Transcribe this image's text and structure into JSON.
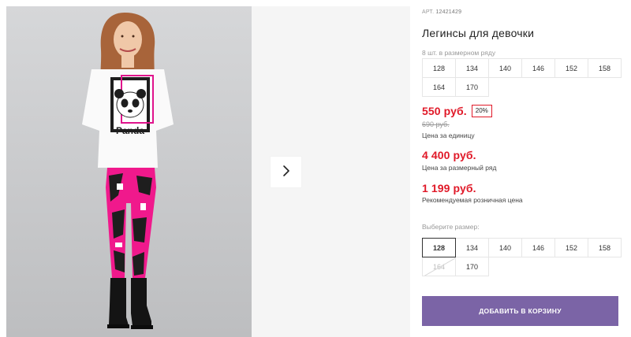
{
  "product": {
    "article_label": "АРТ.",
    "article_number": "12421429",
    "title": "Легинсы для девочки",
    "row_label": "8 шт. в размерном ряду",
    "row_sizes": [
      "128",
      "134",
      "140",
      "146",
      "152",
      "158",
      "164",
      "170"
    ]
  },
  "pricing": {
    "unit_price": "550 руб.",
    "discount_badge": "20%",
    "old_price": "690 руб.",
    "unit_label": "Цена за единицу",
    "row_price": "4 400 руб.",
    "row_label": "Цена за размерный ряд",
    "rrp_price": "1 199 руб.",
    "rrp_label": "Рекомендуемая розничная цена",
    "accent_color": "#e01928"
  },
  "size_select": {
    "label": "Выберите размер:",
    "selected": "128",
    "sizes": [
      {
        "value": "128",
        "state": "selected"
      },
      {
        "value": "134",
        "state": "available"
      },
      {
        "value": "140",
        "state": "available"
      },
      {
        "value": "146",
        "state": "available"
      },
      {
        "value": "152",
        "state": "available"
      },
      {
        "value": "158",
        "state": "available"
      },
      {
        "value": "164",
        "state": "unavailable"
      },
      {
        "value": "170",
        "state": "available"
      }
    ]
  },
  "cart": {
    "button_label": "ДОБАВИТЬ В КОРЗИНУ",
    "button_color": "#7b64a6"
  },
  "gallery": {
    "next_icon": "chevron-right-icon",
    "photo_text": "Panda"
  }
}
